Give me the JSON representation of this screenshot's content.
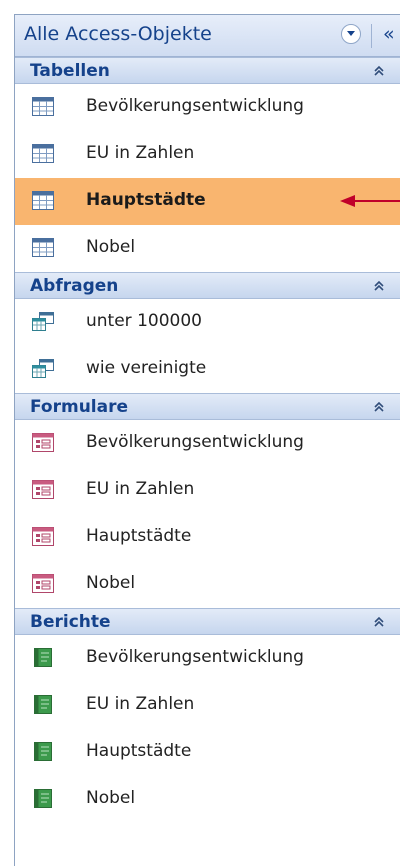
{
  "nav_pane": {
    "title": "Alle Access-Objekte",
    "collapse_symbol": "«"
  },
  "groups": [
    {
      "title": "Tabellen",
      "icon": "table-icon",
      "items": [
        "Bevölkerungsentwicklung",
        "EU in Zahlen",
        "Hauptstädte",
        "Nobel"
      ],
      "selected_index": 2
    },
    {
      "title": "Abfragen",
      "icon": "query-icon",
      "items": [
        "unter 100000",
        "wie vereinigte"
      ]
    },
    {
      "title": "Formulare",
      "icon": "form-icon",
      "items": [
        "Bevölkerungsentwicklung",
        "EU in Zahlen",
        "Hauptstädte",
        "Nobel"
      ]
    },
    {
      "title": "Berichte",
      "icon": "report-icon",
      "items": [
        "Bevölkerungsentwicklung",
        "EU in Zahlen",
        "Hauptstädte",
        "Nobel"
      ]
    }
  ],
  "colors": {
    "selected_background": "#f9b56f",
    "group_text": "#15428b",
    "annotation_arrow": "#c0002a"
  }
}
